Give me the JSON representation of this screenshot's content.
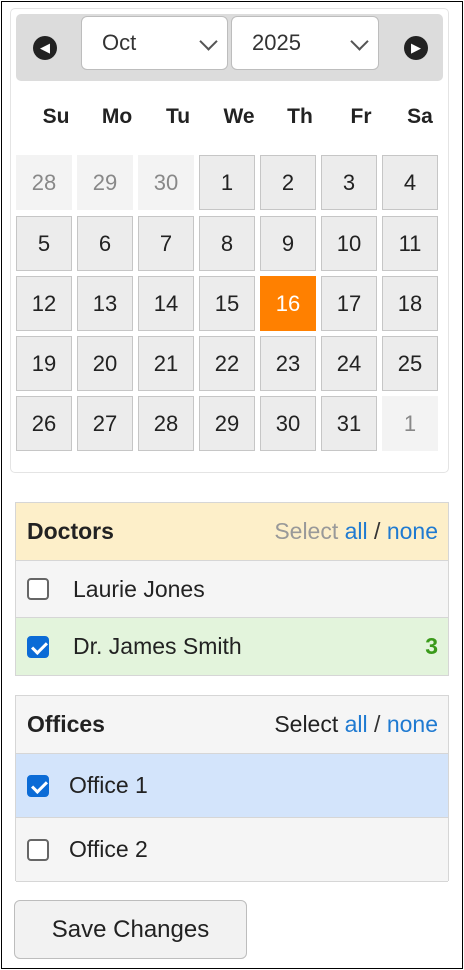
{
  "calendar": {
    "prev_icon": "arrow-left-circle-icon",
    "next_icon": "arrow-right-circle-icon",
    "month": "Oct",
    "year": "2025",
    "weekdays": [
      "Su",
      "Mo",
      "Tu",
      "We",
      "Th",
      "Fr",
      "Sa"
    ],
    "weeks": [
      [
        "28",
        "29",
        "30",
        "1",
        "2",
        "3",
        "4"
      ],
      [
        "5",
        "6",
        "7",
        "8",
        "9",
        "10",
        "11"
      ],
      [
        "12",
        "13",
        "14",
        "15",
        "16",
        "17",
        "18"
      ],
      [
        "19",
        "20",
        "21",
        "22",
        "23",
        "24",
        "25"
      ],
      [
        "26",
        "27",
        "28",
        "29",
        "30",
        "31",
        "1"
      ]
    ],
    "selected_day": "16",
    "accent_color": "#ff8000"
  },
  "doctors": {
    "title": "Doctors",
    "select_label": "Select",
    "all_label": "all",
    "separator": "/",
    "none_label": "none",
    "header_bg": "#fdefc9",
    "items": [
      {
        "name": "Laurie Jones",
        "checked": false,
        "count": ""
      },
      {
        "name": "Dr. James Smith",
        "checked": true,
        "count": "3"
      }
    ]
  },
  "offices": {
    "title": "Offices",
    "select_label": "Select",
    "all_label": "all",
    "separator": "/",
    "none_label": "none",
    "items": [
      {
        "name": "Office 1",
        "checked": true
      },
      {
        "name": "Office 2",
        "checked": false
      }
    ]
  },
  "save_label": "Save Changes"
}
